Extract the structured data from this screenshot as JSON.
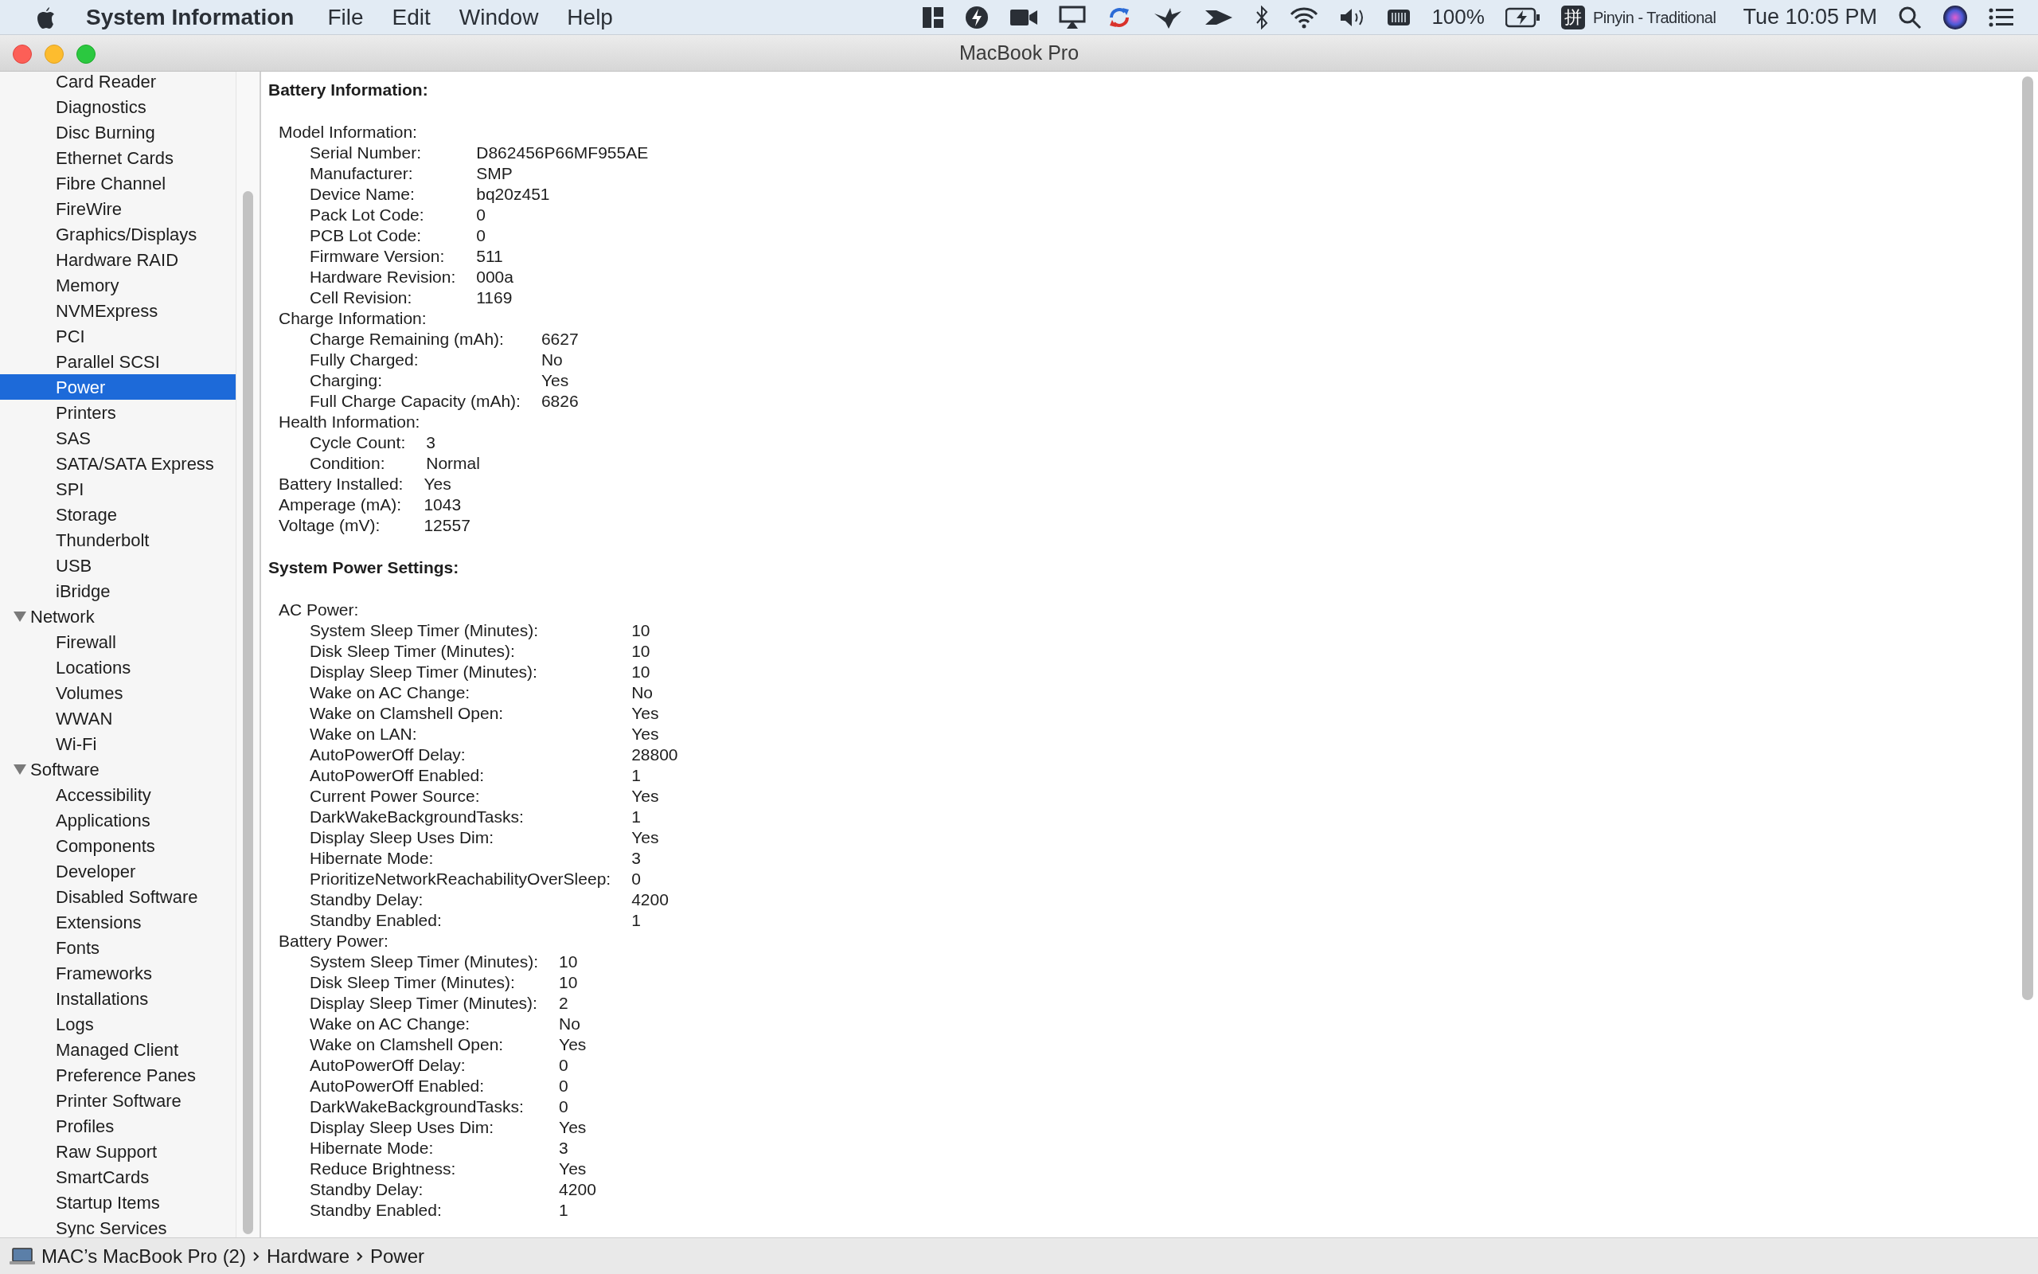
{
  "menu_bar": {
    "app_name": "System Information",
    "menus": [
      "File",
      "Edit",
      "Window",
      "Help"
    ],
    "battery_percent": "100%",
    "input_method_glyph": "拼",
    "input_method": "Pinyin - Traditional",
    "clock": "Tue 10:05 PM"
  },
  "window": {
    "title": "MacBook Pro"
  },
  "sidebar": {
    "items": [
      {
        "label": "Card Reader",
        "selected": false
      },
      {
        "label": "Diagnostics",
        "selected": false
      },
      {
        "label": "Disc Burning",
        "selected": false
      },
      {
        "label": "Ethernet Cards",
        "selected": false
      },
      {
        "label": "Fibre Channel",
        "selected": false
      },
      {
        "label": "FireWire",
        "selected": false
      },
      {
        "label": "Graphics/Displays",
        "selected": false
      },
      {
        "label": "Hardware RAID",
        "selected": false
      },
      {
        "label": "Memory",
        "selected": false
      },
      {
        "label": "NVMExpress",
        "selected": false
      },
      {
        "label": "PCI",
        "selected": false
      },
      {
        "label": "Parallel SCSI",
        "selected": false
      },
      {
        "label": "Power",
        "selected": true
      },
      {
        "label": "Printers",
        "selected": false
      },
      {
        "label": "SAS",
        "selected": false
      },
      {
        "label": "SATA/SATA Express",
        "selected": false
      },
      {
        "label": "SPI",
        "selected": false
      },
      {
        "label": "Storage",
        "selected": false
      },
      {
        "label": "Thunderbolt",
        "selected": false
      },
      {
        "label": "USB",
        "selected": false
      },
      {
        "label": "iBridge",
        "selected": false
      },
      {
        "label": "Network",
        "selected": false,
        "expanded": true,
        "children": [
          {
            "label": "Firewall",
            "selected": false
          },
          {
            "label": "Locations",
            "selected": false
          },
          {
            "label": "Volumes",
            "selected": false
          },
          {
            "label": "WWAN",
            "selected": false
          },
          {
            "label": "Wi-Fi",
            "selected": false
          }
        ]
      },
      {
        "label": "Software",
        "selected": false,
        "expanded": true,
        "children": [
          {
            "label": "Accessibility",
            "selected": false
          },
          {
            "label": "Applications",
            "selected": false
          },
          {
            "label": "Components",
            "selected": false
          },
          {
            "label": "Developer",
            "selected": false
          },
          {
            "label": "Disabled Software",
            "selected": false
          },
          {
            "label": "Extensions",
            "selected": false
          },
          {
            "label": "Fonts",
            "selected": false
          },
          {
            "label": "Frameworks",
            "selected": false
          },
          {
            "label": "Installations",
            "selected": false
          },
          {
            "label": "Logs",
            "selected": false
          },
          {
            "label": "Managed Client",
            "selected": false
          },
          {
            "label": "Preference Panes",
            "selected": false
          },
          {
            "label": "Printer Software",
            "selected": false
          },
          {
            "label": "Profiles",
            "selected": false
          },
          {
            "label": "Raw Support",
            "selected": false
          },
          {
            "label": "SmartCards",
            "selected": false
          },
          {
            "label": "Startup Items",
            "selected": false
          },
          {
            "label": "Sync Services",
            "selected": false
          }
        ]
      }
    ]
  },
  "content": {
    "sections": [
      {
        "title": "Battery Information:",
        "groups": [
          {
            "label": "Model Information:",
            "rows": [
              [
                "Serial Number:",
                "D862456P66MF955AE"
              ],
              [
                "Manufacturer:",
                "SMP"
              ],
              [
                "Device Name:",
                "bq20z451"
              ],
              [
                "Pack Lot Code:",
                "0"
              ],
              [
                "PCB Lot Code:",
                "0"
              ],
              [
                "Firmware Version:",
                "511"
              ],
              [
                "Hardware Revision:",
                "000a"
              ],
              [
                "Cell Revision:",
                "1169"
              ]
            ]
          },
          {
            "label": "Charge Information:",
            "rows": [
              [
                "Charge Remaining (mAh):",
                "6627"
              ],
              [
                "Fully Charged:",
                "No"
              ],
              [
                "Charging:",
                "Yes"
              ],
              [
                "Full Charge Capacity (mAh):",
                "6826"
              ]
            ]
          },
          {
            "label": "Health Information:",
            "rows": [
              [
                "Cycle Count:",
                "3"
              ],
              [
                "Condition:",
                "Normal"
              ]
            ]
          }
        ],
        "rows": [
          [
            "Battery Installed:",
            "Yes"
          ],
          [
            "Amperage (mA):",
            "1043"
          ],
          [
            "Voltage (mV):",
            "12557"
          ]
        ]
      },
      {
        "title": "System Power Settings:",
        "groups": [
          {
            "label": "AC Power:",
            "rows": [
              [
                "System Sleep Timer (Minutes):",
                "10"
              ],
              [
                "Disk Sleep Timer (Minutes):",
                "10"
              ],
              [
                "Display Sleep Timer (Minutes):",
                "10"
              ],
              [
                "Wake on AC Change:",
                "No"
              ],
              [
                "Wake on Clamshell Open:",
                "Yes"
              ],
              [
                "Wake on LAN:",
                "Yes"
              ],
              [
                "AutoPowerOff Delay:",
                "28800"
              ],
              [
                "AutoPowerOff Enabled:",
                "1"
              ],
              [
                "Current Power Source:",
                "Yes"
              ],
              [
                "DarkWakeBackgroundTasks:",
                "1"
              ],
              [
                "Display Sleep Uses Dim:",
                "Yes"
              ],
              [
                "Hibernate Mode:",
                "3"
              ],
              [
                "PrioritizeNetworkReachabilityOverSleep:",
                "0"
              ],
              [
                "Standby Delay:",
                "4200"
              ],
              [
                "Standby Enabled:",
                "1"
              ]
            ]
          },
          {
            "label": "Battery Power:",
            "rows": [
              [
                "System Sleep Timer (Minutes):",
                "10"
              ],
              [
                "Disk Sleep Timer (Minutes):",
                "10"
              ],
              [
                "Display Sleep Timer (Minutes):",
                "2"
              ],
              [
                "Wake on AC Change:",
                "No"
              ],
              [
                "Wake on Clamshell Open:",
                "Yes"
              ],
              [
                "AutoPowerOff Delay:",
                "0"
              ],
              [
                "AutoPowerOff Enabled:",
                "0"
              ],
              [
                "DarkWakeBackgroundTasks:",
                "0"
              ],
              [
                "Display Sleep Uses Dim:",
                "Yes"
              ],
              [
                "Hibernate Mode:",
                "3"
              ],
              [
                "Reduce Brightness:",
                "Yes"
              ],
              [
                "Standby Delay:",
                "4200"
              ],
              [
                "Standby Enabled:",
                "1"
              ]
            ]
          }
        ]
      }
    ]
  },
  "path_bar": [
    "MAC’s MacBook Pro (2)",
    "Hardware",
    "Power"
  ]
}
